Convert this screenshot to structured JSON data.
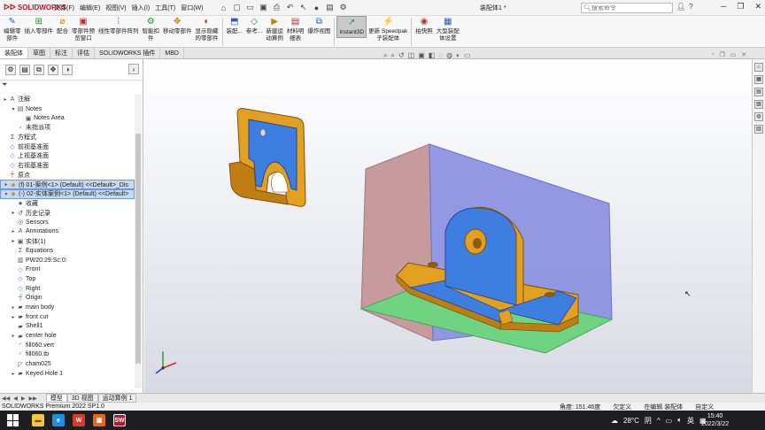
{
  "app": {
    "brand": "SOLIDWORKS",
    "doc_title": "装配体1 *"
  },
  "menus": [
    "文件(F)",
    "编辑(E)",
    "视图(V)",
    "插入(I)",
    "工具(T)",
    "窗口(W)"
  ],
  "search": {
    "placeholder": "搜索命令"
  },
  "ribbon": [
    {
      "l1": "编辑零",
      "l2": "部件",
      "icon": "edit-component-icon"
    },
    {
      "l1": "插入零部件",
      "l2": "",
      "icon": "insert-component-icon"
    },
    {
      "l1": "配合",
      "l2": "",
      "icon": "mate-icon"
    },
    {
      "l1": "零部件预",
      "l2": "览窗口",
      "icon": "preview-window-icon"
    },
    {
      "l1": "线性零部件阵列",
      "l2": "",
      "icon": "linear-pattern-icon"
    },
    {
      "l1": "智能扣",
      "l2": "件",
      "icon": "smart-fastener-icon"
    },
    {
      "l1": "移动零部件",
      "l2": "",
      "icon": "move-component-icon"
    },
    {
      "l1": "显示隐藏",
      "l2": "的零部件",
      "icon": "show-hidden-icon"
    },
    {
      "l1": "装配...",
      "l2": "",
      "icon": "assembly-feature-icon"
    },
    {
      "l1": "参考...",
      "l2": "",
      "icon": "reference-geometry-icon"
    },
    {
      "l1": "新建运",
      "l2": "动算例",
      "icon": "new-motion-study-icon"
    },
    {
      "l1": "材料明",
      "l2": "细表",
      "icon": "bom-icon"
    },
    {
      "l1": "爆炸视图",
      "l2": "",
      "icon": "exploded-view-icon"
    },
    {
      "l1": "Instant3D",
      "l2": "",
      "icon": "instant3d-icon",
      "active": true
    },
    {
      "l1": "更新 Speedpak",
      "l2": "子装配体",
      "icon": "speedpak-icon"
    },
    {
      "l1": "拍快照",
      "l2": "",
      "icon": "snapshot-icon"
    },
    {
      "l1": "大型装配",
      "l2": "体设置",
      "icon": "large-assembly-icon"
    }
  ],
  "tabs": [
    "装配体",
    "草图",
    "标注",
    "评估",
    "SOLIDWORKS 插件",
    "MBD"
  ],
  "tree": [
    {
      "label": "注解",
      "depth": 0,
      "exp": "▸",
      "icon": "annotations-icon"
    },
    {
      "label": "Notes",
      "depth": 1,
      "exp": "▾",
      "icon": "notes-icon"
    },
    {
      "label": "Notes Area",
      "depth": 2,
      "exp": "",
      "icon": "notes-area-icon"
    },
    {
      "label": "未指派项",
      "depth": 1,
      "exp": "",
      "icon": "unassigned-icon"
    },
    {
      "label": "方程式",
      "depth": 0,
      "exp": "",
      "icon": "equations-icon"
    },
    {
      "label": "前视基准面",
      "depth": 0,
      "exp": "",
      "icon": "plane-icon"
    },
    {
      "label": "上视基准面",
      "depth": 0,
      "exp": "",
      "icon": "plane-icon"
    },
    {
      "label": "右视基准面",
      "depth": 0,
      "exp": "",
      "icon": "plane-icon"
    },
    {
      "label": "原点",
      "depth": 0,
      "exp": "",
      "icon": "origin-icon"
    },
    {
      "label": "(f) 01-案例<1> (Default) <<Default>_Dis",
      "depth": 0,
      "exp": "▸",
      "icon": "part-icon",
      "sel": true
    },
    {
      "label": "(-) 02-实体案例<1> (Default) <<Default>",
      "depth": 0,
      "exp": "▾",
      "icon": "part-icon",
      "sel": true
    },
    {
      "label": "收藏",
      "depth": 1,
      "exp": "",
      "icon": "favorites-icon"
    },
    {
      "label": "历史记录",
      "depth": 1,
      "exp": "▸",
      "icon": "history-icon"
    },
    {
      "label": "Sensors",
      "depth": 1,
      "exp": "",
      "icon": "sensors-icon"
    },
    {
      "label": "Annotations",
      "depth": 1,
      "exp": "▸",
      "icon": "annotations-icon"
    },
    {
      "label": "实体(1)",
      "depth": 1,
      "exp": "▸",
      "icon": "solid-bodies-icon"
    },
    {
      "label": "Equations",
      "depth": 1,
      "exp": "",
      "icon": "equations-icon"
    },
    {
      "label": "PW20:29:Sc:0:",
      "depth": 1,
      "exp": "",
      "icon": "material-icon"
    },
    {
      "label": "Front",
      "depth": 1,
      "exp": "",
      "icon": "plane-icon"
    },
    {
      "label": "Top",
      "depth": 1,
      "exp": "",
      "icon": "plane-icon"
    },
    {
      "label": "Right",
      "depth": 1,
      "exp": "",
      "icon": "plane-icon"
    },
    {
      "label": "Origin",
      "depth": 1,
      "exp": "",
      "icon": "origin-icon"
    },
    {
      "label": "main body",
      "depth": 1,
      "exp": "▸",
      "icon": "feature-icon"
    },
    {
      "label": "front cut",
      "depth": 1,
      "exp": "▸",
      "icon": "feature-icon"
    },
    {
      "label": "Shell1",
      "depth": 1,
      "exp": "",
      "icon": "feature-icon"
    },
    {
      "label": "center hole",
      "depth": 1,
      "exp": "▸",
      "icon": "feature-icon"
    },
    {
      "label": "fill060.vert",
      "depth": 1,
      "exp": "",
      "icon": "fillet-icon"
    },
    {
      "label": "fill060.tb",
      "depth": 1,
      "exp": "",
      "icon": "fillet-icon"
    },
    {
      "label": "cham025",
      "depth": 1,
      "exp": "",
      "icon": "chamfer-icon"
    },
    {
      "label": "Keyed Hole 1",
      "depth": 1,
      "exp": "▸",
      "icon": "feature-icon"
    }
  ],
  "bottom_tabs": [
    "模型",
    "3D 视图",
    "运动算例 1"
  ],
  "status": {
    "product": "SOLIDWORKS Premium 2022 SP1.0",
    "angle": "角度: 151.46度",
    "defined": "欠定义",
    "editing": "在编辑 装配体",
    "custom": "自定义"
  },
  "taskbar": {
    "temperature": "28°C",
    "weather": "阴",
    "lang": "英",
    "time": "15:40",
    "date": "2022/3/22"
  },
  "colors": {
    "part": "#e3a020",
    "face_blue": "#3e7ee0",
    "plane_blue": "#8a90df",
    "plane_red": "#c79a9e",
    "plane_green": "#6ed482"
  }
}
